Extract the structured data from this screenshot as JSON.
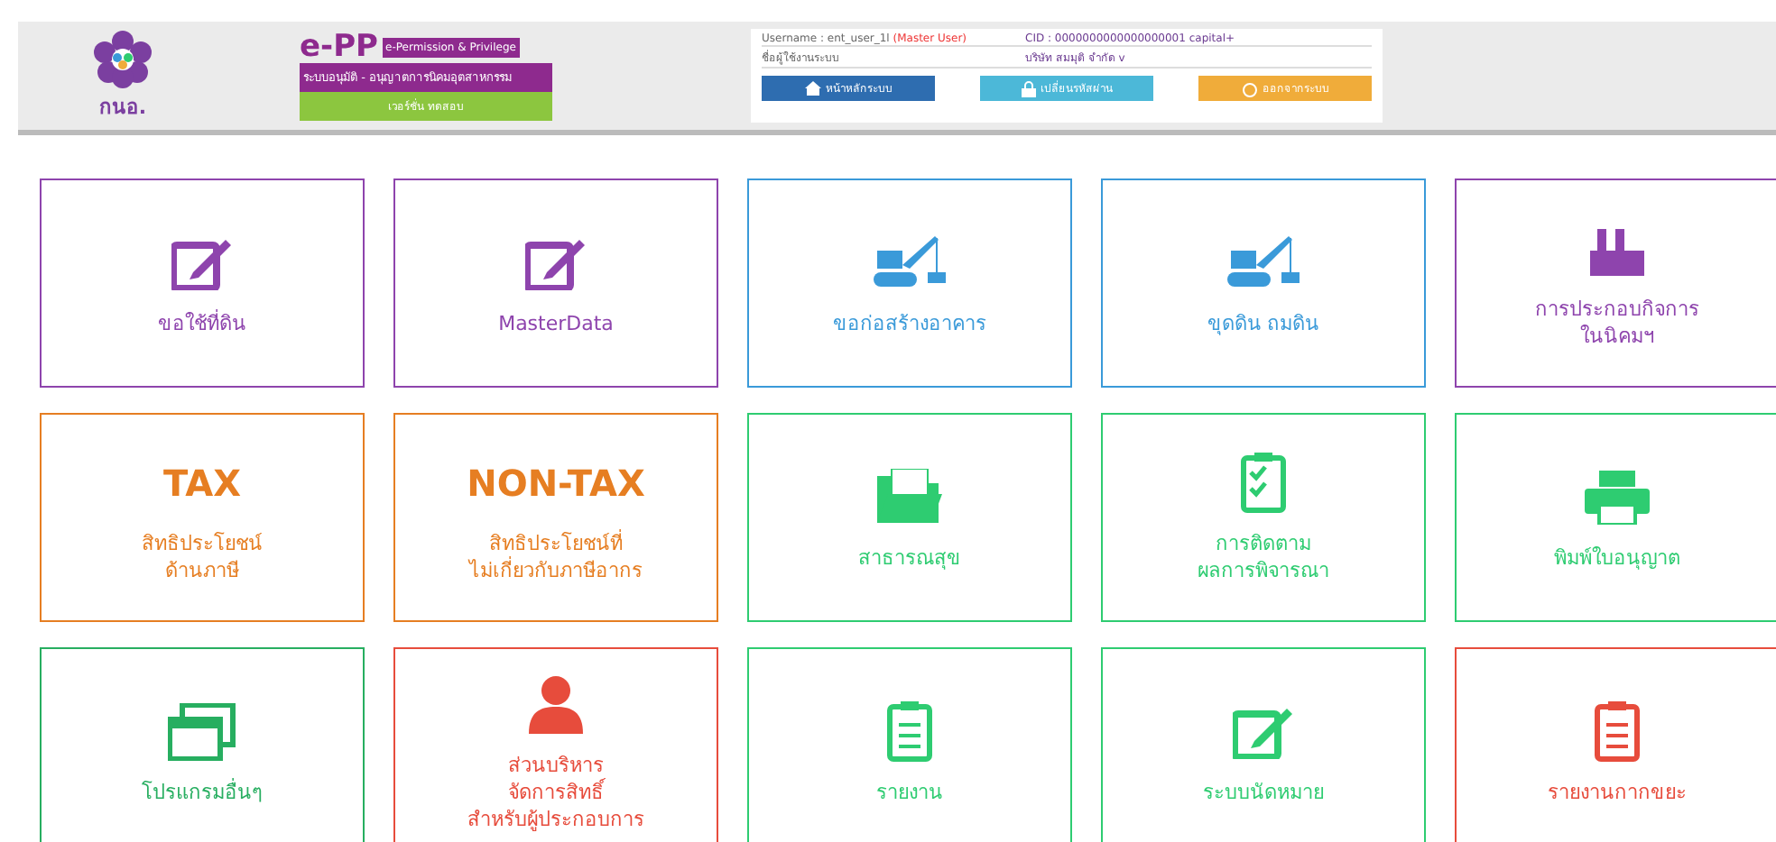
{
  "header": {
    "logo_text": "กนอ.",
    "app_name": "e-PP",
    "app_subtitle": "e-Permission & Privilege",
    "app_tagline": "ระบบอนุมัติ - อนุญาตการนิคมอุตสาหกรรม",
    "app_version": "เวอร์ชั่น ทดสอบ",
    "username": "Username : ent_user_1l",
    "user_role": "(Master User)",
    "user_name": "ชื่อผู้ใช้งานระบบ",
    "company_id": "CID : 0000000000000000001 capital+",
    "company_name": "บริษัท สมมุติ จำกัด v",
    "buttons": [
      {
        "label": "หน้าหลักระบบ",
        "kind": "home",
        "color": "#2e6db0"
      },
      {
        "label": "เปลี่ยนรหัสผ่าน",
        "kind": "lock",
        "color": "#4cb8d8"
      },
      {
        "label": "ออกจากระบบ",
        "kind": "power",
        "color": "#f0ac3a"
      }
    ]
  },
  "tiles": [
    {
      "kind": "pencil",
      "lines": [
        "ขอใช้ที่ดิน"
      ],
      "color": "#8e44ad"
    },
    {
      "kind": "pencil",
      "lines": [
        "MasterData"
      ],
      "color": "#8e44ad"
    },
    {
      "kind": "crane",
      "lines": [
        "ขอก่อสร้างอาคาร"
      ],
      "color": "#3a9ad9"
    },
    {
      "kind": "crane",
      "lines": [
        "ขุดดิน ถมดิน"
      ],
      "color": "#3a9ad9"
    },
    {
      "kind": "factory",
      "lines": [
        "การประกอบกิจการ",
        "ในนิคมฯ"
      ],
      "color": "#8e44ad"
    },
    {
      "kind": "word",
      "word": "TAX",
      "lines": [
        "สิทธิประโยชน์",
        "ด้านภาษี"
      ],
      "color": "#e67e22"
    },
    {
      "kind": "word",
      "word": "NON-TAX",
      "lines": [
        "สิทธิประโยชน์ที่",
        "ไม่เกี่ยวกับภาษีอากร"
      ],
      "color": "#e67e22"
    },
    {
      "kind": "folder",
      "lines": [
        "สาธารณสุข"
      ],
      "color": "#2ecc71"
    },
    {
      "kind": "checklist",
      "lines": [
        "การติดตาม",
        "ผลการพิจารณา"
      ],
      "color": "#2ecc71"
    },
    {
      "kind": "printer",
      "lines": [
        "พิมพ์ใบอนุญาต"
      ],
      "color": "#2ecc71"
    },
    {
      "kind": "windows",
      "lines": [
        "โปรแกรมอื่นๆ"
      ],
      "color": "#27ae60"
    },
    {
      "kind": "person",
      "lines": [
        "ส่วนบริหาร",
        "จัดการสิทธิ์",
        "สำหรับผู้ประกอบการ"
      ],
      "color": "#e74c3c"
    },
    {
      "kind": "clipboard",
      "lines": [
        "รายงาน"
      ],
      "color": "#2ecc71"
    },
    {
      "kind": "pencil",
      "lines": [
        "ระบบนัดหมาย"
      ],
      "color": "#2ecc71"
    },
    {
      "kind": "clipboard",
      "lines": [
        "รายงานกากขยะ"
      ],
      "color": "#e74c3c"
    }
  ]
}
